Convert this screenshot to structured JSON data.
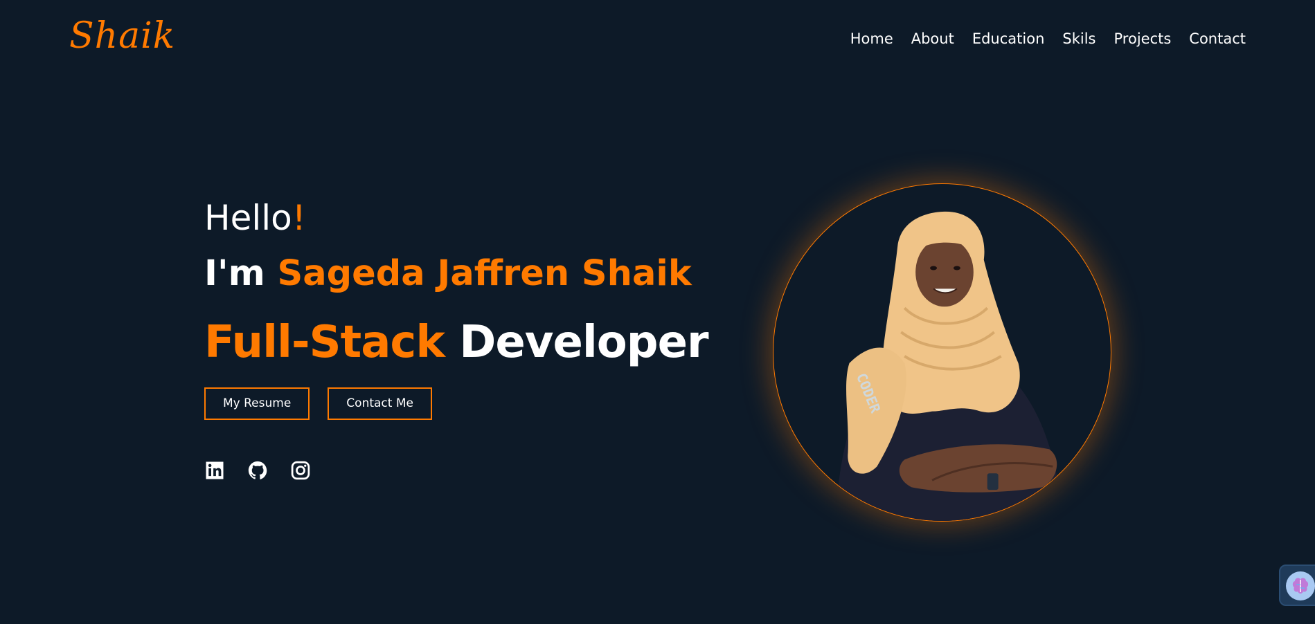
{
  "nav": {
    "logo": "Shaik",
    "links": [
      "Home",
      "About",
      "Education",
      "Skils",
      "Projects",
      "Contact"
    ]
  },
  "hero": {
    "greeting": "Hello",
    "greeting_mark": "!",
    "intro_prefix": "I'm ",
    "name": "Sageda Jaffren Shaik",
    "role_accent": "Full-Stack",
    "role_rest": " Developer",
    "buttons": {
      "resume": "My Resume",
      "contact": "Contact Me"
    },
    "socials": [
      "linkedin-icon",
      "github-icon",
      "instagram-icon"
    ]
  },
  "colors": {
    "background": "#0d1a28",
    "accent": "#ff7a00",
    "text": "#ffffff"
  }
}
